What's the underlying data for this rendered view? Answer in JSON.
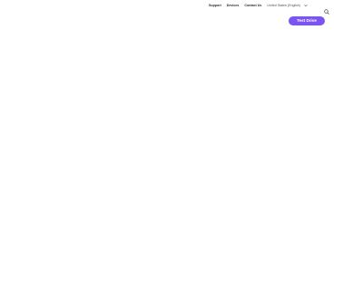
{
  "nav": {
    "support": "Support",
    "devices": "Devices",
    "contact": "Contact Us",
    "locale": "United States (English)"
  },
  "icons": {
    "chevron": "chevron-down-icon",
    "search": "search-icon"
  },
  "cta": {
    "label": "Test Drive",
    "color": "#7a55f2"
  }
}
